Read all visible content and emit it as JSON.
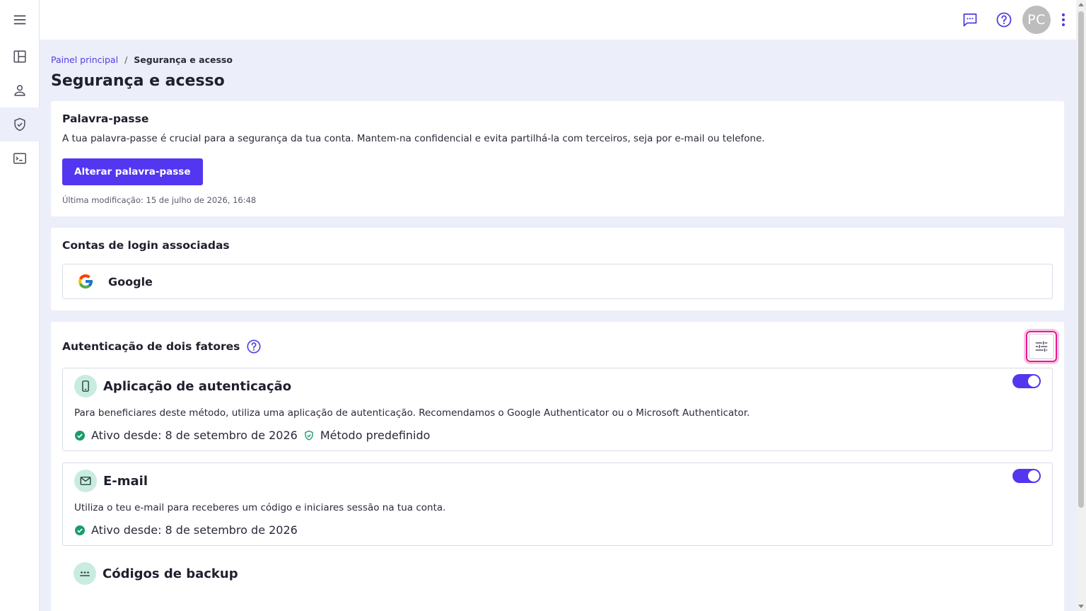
{
  "colors": {
    "primary": "#5236f0",
    "accent_green": "#1a9c6b",
    "highlight": "#e8188f"
  },
  "sidebar": {
    "items": [
      {
        "icon": "menu-icon"
      },
      {
        "icon": "dashboard-icon"
      },
      {
        "icon": "person-icon"
      },
      {
        "icon": "shield-check-icon",
        "active": true
      },
      {
        "icon": "terminal-icon"
      }
    ]
  },
  "header": {
    "icons": [
      "feedback-icon",
      "help-circle-icon",
      "more-vert-icon"
    ],
    "avatar_initials": "PC"
  },
  "breadcrumb": {
    "parent": "Painel principal",
    "separator": "/",
    "current": "Segurança e acesso"
  },
  "page": {
    "title": "Segurança e acesso"
  },
  "password": {
    "title": "Palavra-passe",
    "description": "A tua palavra-passe é crucial para a segurança da tua conta. Mantem-na confidencial e evita partilhá-la com terceiros, seja por e-mail ou telefone.",
    "button_label": "Alterar palavra-passe",
    "last_modified": "Última modificação: 15 de julho de 2026, 16:48"
  },
  "login_accounts": {
    "title": "Contas de login associadas",
    "items": [
      {
        "name": "Google",
        "icon": "google-icon"
      }
    ]
  },
  "two_factor": {
    "title": "Autenticação de dois fatores",
    "methods": [
      {
        "name": "Aplicação de autenticação",
        "icon": "smartphone-icon",
        "description": "Para beneficiares deste método, utiliza uma aplicação de autenticação. Recomendamos o Google Authenticator ou o Microsoft Authenticator.",
        "status": "Ativo desde: 8 de setembro de 2026",
        "default_label": "Método predefinido",
        "enabled": true
      },
      {
        "name": "E-mail",
        "icon": "mail-icon",
        "description": "Utiliza o teu e-mail para receberes um código e iniciares sessão na tua conta.",
        "status": "Ativo desde: 8 de setembro de 2026",
        "enabled": true
      },
      {
        "name": "Códigos de backup",
        "icon": "password-dots-icon"
      }
    ]
  }
}
